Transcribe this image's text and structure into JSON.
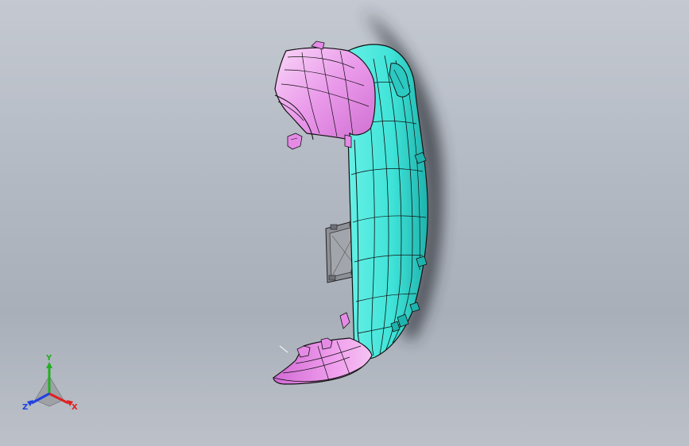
{
  "viewport": {
    "background_top": "#c4c9d1",
    "background_bottom": "#a9afb9"
  },
  "model": {
    "colors": {
      "bumper_fascia": "#3fe3d8",
      "bumper_shade": "#22b9b2",
      "end_caps": "#e58be6",
      "end_caps_light": "#f7c8f5",
      "bracket": "#8d9097",
      "edges": "#111111"
    }
  },
  "triad": {
    "x_label": "X",
    "y_label": "Y",
    "z_label": "Z",
    "x_color": "#e02020",
    "y_color": "#20b020",
    "z_color": "#2040e0"
  }
}
